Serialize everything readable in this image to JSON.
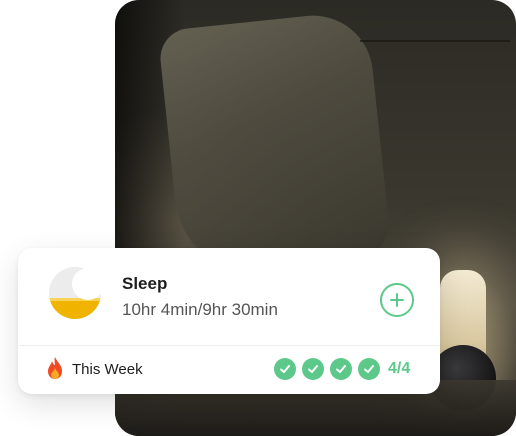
{
  "card": {
    "title": "Sleep",
    "duration": "10hr 4min/9hr 30min",
    "add_icon": "plus-circle-icon",
    "week_label": "This Week",
    "week_icon": "flame-icon",
    "completed_days": 4,
    "goal_days": 4,
    "count_text": "4/4",
    "check_icon": "check-circle-icon",
    "accent_color": "#5cc98a"
  },
  "photo": {
    "subject": "bedroom-night-photo"
  }
}
